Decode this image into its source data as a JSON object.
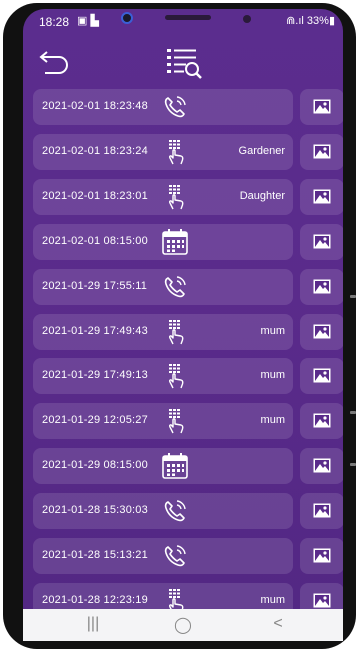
{
  "status_bar": {
    "time": "18:28",
    "notifications": "▣ ▙",
    "right": "⋒.ıl 33%▮"
  },
  "header": {
    "back_icon": "back-arrow-icon",
    "filter_icon": "list-search-icon"
  },
  "log": [
    {
      "timestamp": "2021-02-01 18:23:48",
      "type": "call",
      "name": ""
    },
    {
      "timestamp": "2021-02-01 18:23:24",
      "type": "keypad",
      "name": "Gardener"
    },
    {
      "timestamp": "2021-02-01 18:23:01",
      "type": "keypad",
      "name": "Daughter"
    },
    {
      "timestamp": "2021-02-01 08:15:00",
      "type": "schedule",
      "name": ""
    },
    {
      "timestamp": "2021-01-29 17:55:11",
      "type": "call",
      "name": ""
    },
    {
      "timestamp": "2021-01-29 17:49:43",
      "type": "keypad",
      "name": "mum"
    },
    {
      "timestamp": "2021-01-29 17:49:13",
      "type": "keypad",
      "name": "mum"
    },
    {
      "timestamp": "2021-01-29 12:05:27",
      "type": "keypad",
      "name": "mum"
    },
    {
      "timestamp": "2021-01-29 08:15:00",
      "type": "schedule",
      "name": ""
    },
    {
      "timestamp": "2021-01-28 15:30:03",
      "type": "call",
      "name": ""
    },
    {
      "timestamp": "2021-01-28 15:13:21",
      "type": "call",
      "name": ""
    },
    {
      "timestamp": "2021-01-28 12:23:19",
      "type": "keypad",
      "name": "mum"
    }
  ],
  "nav_bar": {
    "recent": "|||",
    "home": "◯",
    "back": "<"
  },
  "colors": {
    "background": "#5a2b8b",
    "row": "rgba(255,255,255,0.12)"
  }
}
